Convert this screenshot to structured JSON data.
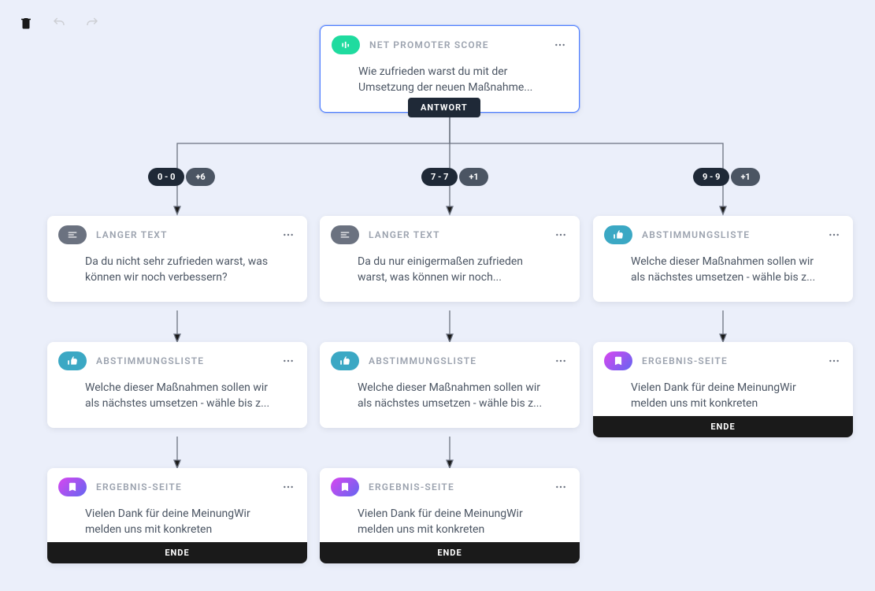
{
  "toolbar": {
    "undo": "undo",
    "redo": "redo",
    "delete": "delete"
  },
  "root": {
    "type_label": "NET PROMOTER SCORE",
    "body": "Wie zufrieden warst du mit der Umsetzung der neuen Maßnahme...",
    "answer_badge": "ANTWORT"
  },
  "branches": [
    {
      "range": "0 - 0",
      "plus": "+6"
    },
    {
      "range": "7 - 7",
      "plus": "+1"
    },
    {
      "range": "9 - 9",
      "plus": "+1"
    }
  ],
  "col1": {
    "c1": {
      "type_label": "LANGER TEXT",
      "body": "Da du nicht sehr zufrieden warst, was können wir noch verbessern?"
    },
    "c2": {
      "type_label": "ABSTIMMUNGSLISTE",
      "body": "Welche dieser Maßnahmen sollen wir als nächstes umsetzen - wähle bis z..."
    },
    "c3": {
      "type_label": "ERGEBNIS-SEITE",
      "body": "Vielen Dank für deine MeinungWir melden uns mit konkreten",
      "ende": "ENDE"
    }
  },
  "col2": {
    "c1": {
      "type_label": "LANGER TEXT",
      "body": "Da du nur einigermaßen zufrieden warst, was können wir noch..."
    },
    "c2": {
      "type_label": "ABSTIMMUNGSLISTE",
      "body": "Welche dieser Maßnahmen sollen wir als nächstes umsetzen - wähle bis z..."
    },
    "c3": {
      "type_label": "ERGEBNIS-SEITE",
      "body": "Vielen Dank für deine MeinungWir melden uns mit konkreten",
      "ende": "ENDE"
    }
  },
  "col3": {
    "c1": {
      "type_label": "ABSTIMMUNGSLISTE",
      "body": "Welche dieser Maßnahmen sollen wir als nächstes umsetzen - wähle bis z..."
    },
    "c2": {
      "type_label": "ERGEBNIS-SEITE",
      "body": "Vielen Dank für deine MeinungWir melden uns mit konkreten",
      "ende": "ENDE"
    }
  }
}
